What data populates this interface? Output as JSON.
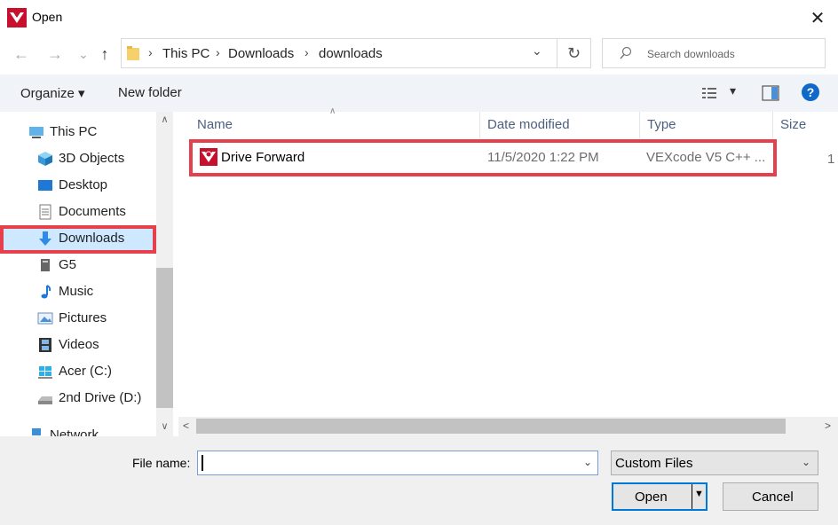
{
  "window": {
    "title": "Open",
    "close_glyph": "✕"
  },
  "nav": {
    "back_glyph": "←",
    "forward_glyph": "→",
    "recent_glyph": "⌄",
    "up_glyph": "↑",
    "breadcrumbs": [
      "This PC",
      "Downloads",
      "downloads"
    ],
    "sep_glyph": "›",
    "refresh_glyph": "↻",
    "dd_glyph": "⌄",
    "search_placeholder": "Search downloads"
  },
  "toolbar": {
    "organize_label": "Organize ▾",
    "new_folder_label": "New folder",
    "dd_glyph": "▾",
    "help_glyph": "?"
  },
  "sidebar": {
    "items": [
      {
        "label": "This PC",
        "icon": "pc-icon"
      },
      {
        "label": "3D Objects",
        "icon": "cube-icon"
      },
      {
        "label": "Desktop",
        "icon": "desktop-icon"
      },
      {
        "label": "Documents",
        "icon": "document-icon"
      },
      {
        "label": "Downloads",
        "icon": "download-arrow-icon"
      },
      {
        "label": "G5",
        "icon": "drive-icon"
      },
      {
        "label": "Music",
        "icon": "music-note-icon"
      },
      {
        "label": "Pictures",
        "icon": "picture-icon"
      },
      {
        "label": "Videos",
        "icon": "film-icon"
      },
      {
        "label": "Acer (C:)",
        "icon": "windows-drive-icon"
      },
      {
        "label": "2nd Drive (D:)",
        "icon": "drive-icon"
      },
      {
        "label": "Network",
        "icon": "network-icon"
      }
    ],
    "up_glyph": "∧",
    "down_glyph": "∨"
  },
  "columns": {
    "name": "Name",
    "date": "Date modified",
    "type": "Type",
    "size": "Size",
    "sort_glyph": "∧"
  },
  "files": [
    {
      "name": "Drive Forward",
      "date": "11/5/2020 1:22 PM",
      "type": "VEXcode V5 C++ ...",
      "size": "1"
    }
  ],
  "hscroll": {
    "left_glyph": "<",
    "right_glyph": ">"
  },
  "bottom": {
    "file_name_label": "File name:",
    "file_name_value": "",
    "filter_value": "Custom Files",
    "dd_glyph": "⌄",
    "open_label": "Open",
    "open_dd_glyph": "▼",
    "cancel_label": "Cancel"
  },
  "colors": {
    "highlight_border": "#e5404b",
    "accent": "#0078d7",
    "vex_red": "#c8102e"
  }
}
